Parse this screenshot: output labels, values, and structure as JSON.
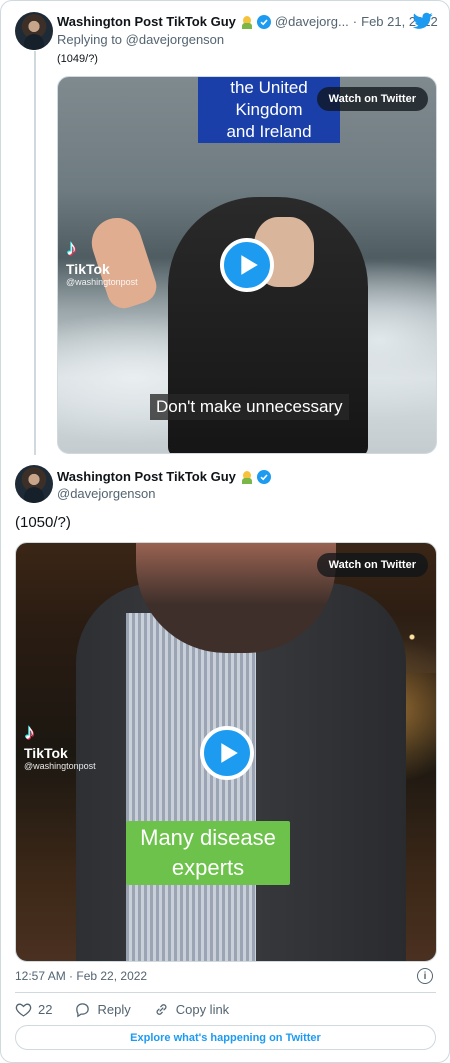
{
  "tweet1": {
    "author_name": "Washington Post TikTok Guy",
    "handle": "@davejorg...",
    "separator": "·",
    "date": "Feb 21, 2022",
    "replying_to": "Replying to @davejorgenson",
    "text": "(1049/?)",
    "media": {
      "caption_top": "the United Kingdom and Ireland",
      "caption_line1": "the United Kingdom",
      "caption_line2": "and Ireland",
      "caption_bottom": "Don't make unnecessary",
      "watch_label": "Watch on Twitter",
      "tiktok_name": "TikTok",
      "tiktok_handle": "@washingtonpost"
    }
  },
  "tweet2": {
    "author_name": "Washington Post TikTok Guy",
    "handle": "@davejorgenson",
    "text": "(1050/?)",
    "media": {
      "caption_line1": "Many disease",
      "caption_line2": "experts",
      "watch_label": "Watch on Twitter",
      "tiktok_name": "TikTok",
      "tiktok_handle": "@washingtonpost"
    },
    "timestamp": "12:57 AM · Feb 22, 2022",
    "likes": "22",
    "reply_label": "Reply",
    "copy_link_label": "Copy link"
  },
  "footer": {
    "explore_label": "Explore what's happening on Twitter"
  },
  "colors": {
    "accent": "#1d9bf0",
    "muted": "#536471",
    "border": "#cfd9de"
  }
}
